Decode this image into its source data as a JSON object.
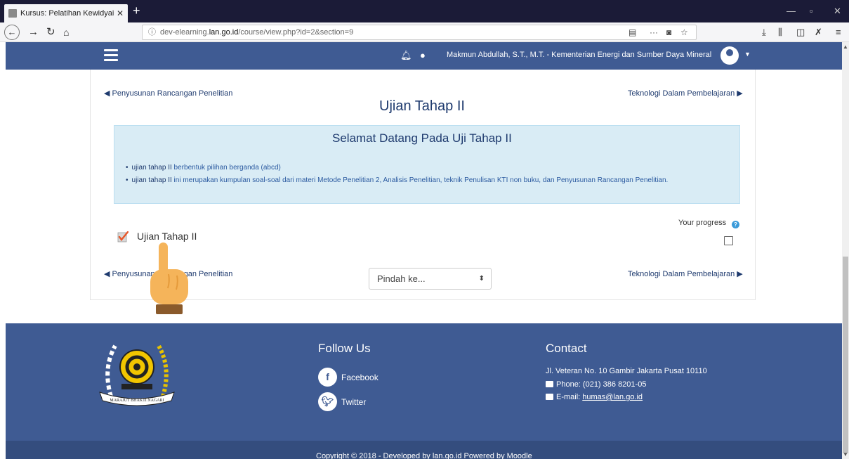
{
  "browser": {
    "tab_title": "Kursus: Pelatihan Kewidyaiswar",
    "tab_close": "✕",
    "new_tab": "+",
    "url_prefix": "dev-elearning.",
    "url_domain": "lan.go.id",
    "url_path": "/course/view.php?id=2&section=9",
    "url_more": "···"
  },
  "header": {
    "username": "Makmun Abdullah, S.T., M.T. - Kementerian Energi dan Sumber Daya Mineral"
  },
  "section": {
    "prev_link": "◀ Penyusunan Rancangan Penelitian",
    "next_link": "Teknologi Dalam Pembelajaran ▶",
    "title": "Ujian Tahap II",
    "summary_heading": "Selamat Datang Pada Uji Tahap II",
    "bullets": [
      {
        "strong": "ujian tahap II",
        "text": " berbentuk pilihan berganda (abcd)"
      },
      {
        "strong": "ujian tahap II",
        "text": " ini merupakan kumpulan soal-soal dari materi Metode Penelitian 2, Analisis Penelitian, teknik Penulisan KTI non buku, dan Penyusunan Rancangan Penelitian."
      }
    ],
    "progress_label": "Your progress",
    "help_glyph": "?",
    "activity_name": "Ujian Tahap II",
    "bottom_prev_link": "◀ Penyusunan Rancangan Penelitian",
    "bottom_next_link": "Teknologi Dalam Pembelajaran ▶",
    "jump_placeholder": "Pindah ke...",
    "jump_arrows": "⬍"
  },
  "footer": {
    "follow_heading": "Follow Us",
    "facebook": "Facebook",
    "twitter": "Twitter",
    "contact_heading": "Contact",
    "address": "Jl. Veteran No. 10 Gambir Jakarta Pusat 10110",
    "phone": "Phone: (021) 386 8201-05",
    "email_label": "E-mail: ",
    "email": "humas@lan.go.id",
    "logo_motto": "MARAJUT BHAKTI NAGARI",
    "copyright": "Copyright © 2018 - Developed by lan.go.id Powered by Moodle"
  },
  "colors": {
    "brand": "#3f5b93",
    "link": "#1e3a6e",
    "summary_bg": "#d9ecf5"
  },
  "icons": [
    "back-icon",
    "forward-icon",
    "reload-icon",
    "home-icon",
    "info-icon",
    "reader-icon",
    "pocket-icon",
    "bookmark-star-icon",
    "download-icon",
    "library-icon",
    "sidebar-icon",
    "close-x-icon",
    "menu-icon",
    "bell-icon",
    "chat-icon",
    "user-avatar-icon",
    "help-icon",
    "quiz-icon",
    "pointer-hand-icon",
    "facebook-icon",
    "twitter-icon",
    "phone-icon",
    "email-icon"
  ]
}
